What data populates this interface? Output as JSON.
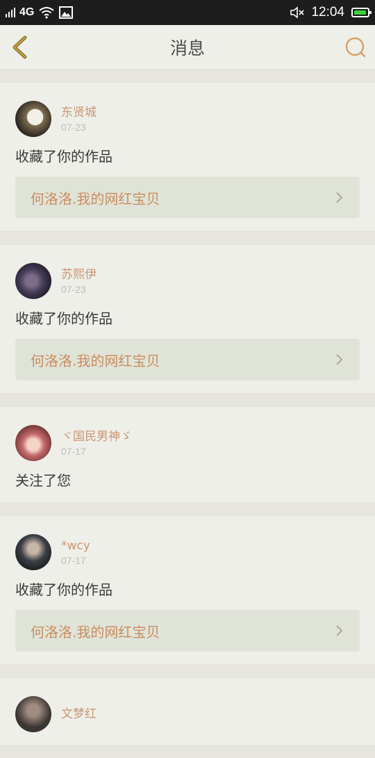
{
  "status_bar": {
    "network": "4G",
    "time": "12:04",
    "battery_color": "#39d23b"
  },
  "header": {
    "title": "消息",
    "back_icon": "chevron-left-icon",
    "search_icon": "search-icon",
    "accent": "#c98a3c"
  },
  "notifications": [
    {
      "user": "东贤城",
      "date": "07-23",
      "action": "收藏了你的作品",
      "work_title": "何洛洛.我的网红宝贝"
    },
    {
      "user": "苏熙伊",
      "date": "07-23",
      "action": "收藏了你的作品",
      "work_title": "何洛洛.我的网红宝贝"
    },
    {
      "user": "ヾ国民男神ゞ",
      "date": "07-17",
      "action": "关注了您"
    },
    {
      "user": "*wcy",
      "date": "07-17",
      "action": "收藏了你的作品",
      "work_title": "何洛洛.我的网红宝贝"
    },
    {
      "user": "文梦红"
    }
  ]
}
